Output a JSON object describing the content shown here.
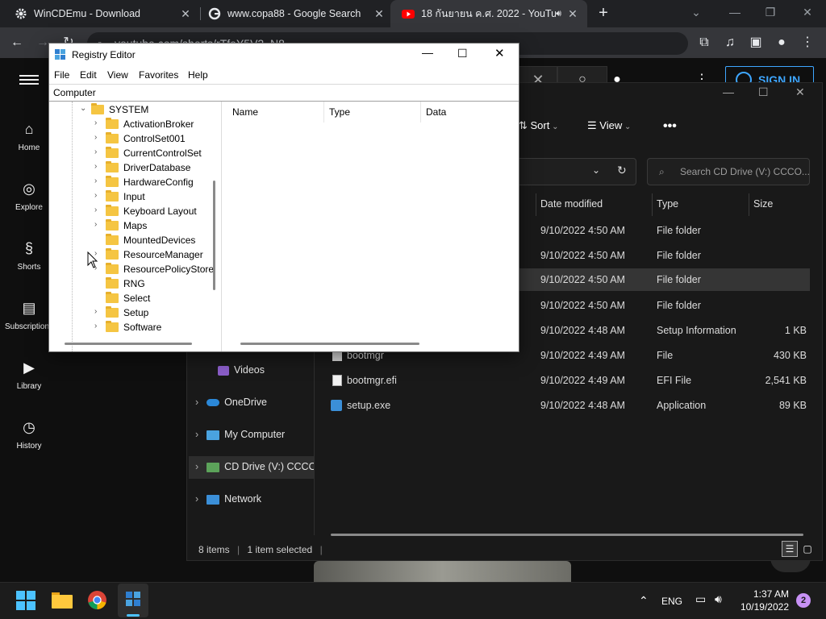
{
  "browser": {
    "tabs": [
      {
        "title": "WinCDEmu - Download",
        "icon": "gear-icon"
      },
      {
        "title": "www.copa88 - Google Search",
        "icon": "google-icon"
      },
      {
        "title": "18 กันยายน ค.ศ. 2022 - YouTu",
        "icon": "youtube-icon"
      }
    ],
    "url": "youtube.com/shorts/rTfeY5V2_N8"
  },
  "youtube": {
    "nav": [
      {
        "label": "Home",
        "icon": "home-icon"
      },
      {
        "label": "Explore",
        "icon": "compass-icon"
      },
      {
        "label": "Shorts",
        "icon": "shorts-icon"
      },
      {
        "label": "Subscriptions",
        "icon": "subscriptions-icon"
      },
      {
        "label": "Library",
        "icon": "library-icon"
      },
      {
        "label": "History",
        "icon": "history-icon"
      }
    ],
    "sign_in": "SIGN IN"
  },
  "explorer": {
    "sort_label": "Sort",
    "view_label": "View",
    "search_placeholder": "Search CD Drive (V:) CCCO...",
    "columns": [
      "Date modified",
      "Type",
      "Size"
    ],
    "files": [
      {
        "name": "",
        "date": "9/10/2022 4:50 AM",
        "type": "File folder",
        "size": ""
      },
      {
        "name": "",
        "date": "9/10/2022 4:50 AM",
        "type": "File folder",
        "size": ""
      },
      {
        "name": "",
        "date": "9/10/2022 4:50 AM",
        "type": "File folder",
        "size": ""
      },
      {
        "name": "",
        "date": "9/10/2022 4:50 AM",
        "type": "File folder",
        "size": ""
      },
      {
        "name": "",
        "date": "9/10/2022 4:48 AM",
        "type": "Setup Information",
        "size": "1 KB"
      },
      {
        "name": "bootmgr",
        "date": "9/10/2022 4:49 AM",
        "type": "File",
        "size": "430 KB"
      },
      {
        "name": "bootmgr.efi",
        "date": "9/10/2022 4:49 AM",
        "type": "EFI File",
        "size": "2,541 KB"
      },
      {
        "name": "setup.exe",
        "date": "9/10/2022 4:48 AM",
        "type": "Application",
        "size": "89 KB"
      }
    ],
    "nav": {
      "videos": "Videos",
      "onedrive": "OneDrive",
      "mycomputer": "My Computer",
      "cddrive": "CD Drive (V:) CCCOI",
      "network": "Network"
    },
    "status_items": "8 items",
    "status_selected": "1 item selected"
  },
  "regedit": {
    "title": "Registry Editor",
    "menu": [
      "File",
      "Edit",
      "View",
      "Favorites",
      "Help"
    ],
    "address": "Computer",
    "tree_root": "SYSTEM",
    "tree": [
      {
        "label": "ActivationBroker",
        "expandable": true
      },
      {
        "label": "ControlSet001",
        "expandable": true
      },
      {
        "label": "CurrentControlSet",
        "expandable": true
      },
      {
        "label": "DriverDatabase",
        "expandable": true
      },
      {
        "label": "HardwareConfig",
        "expandable": true
      },
      {
        "label": "Input",
        "expandable": true
      },
      {
        "label": "Keyboard Layout",
        "expandable": true
      },
      {
        "label": "Maps",
        "expandable": true
      },
      {
        "label": "MountedDevices",
        "expandable": false
      },
      {
        "label": "ResourceManager",
        "expandable": true
      },
      {
        "label": "ResourcePolicyStore",
        "expandable": true
      },
      {
        "label": "RNG",
        "expandable": false
      },
      {
        "label": "Select",
        "expandable": false
      },
      {
        "label": "Setup",
        "expandable": true
      },
      {
        "label": "Software",
        "expandable": true
      }
    ],
    "columns": [
      "Name",
      "Type",
      "Data"
    ]
  },
  "taskbar": {
    "lang": "ENG",
    "time": "1:37 AM",
    "date": "10/19/2022",
    "notifications": "2"
  }
}
